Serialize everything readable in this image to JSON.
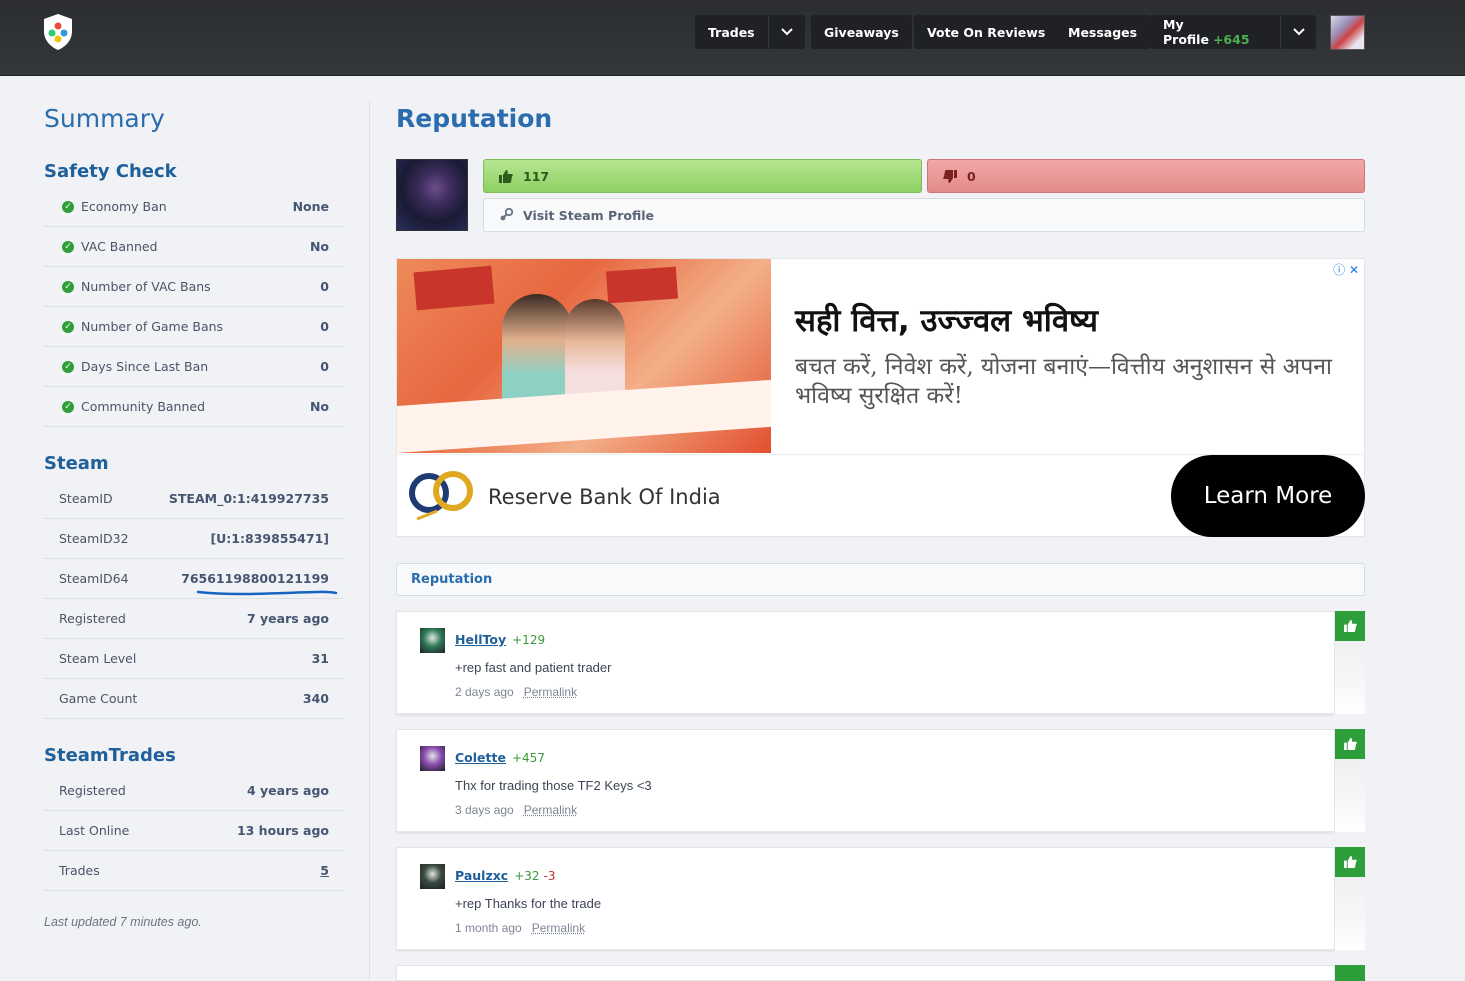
{
  "nav": {
    "trades": "Trades",
    "giveaways": "Giveaways",
    "vote_on_reviews": "Vote On Reviews",
    "messages": "Messages",
    "my_profile": "My Profile",
    "my_profile_points": "+645"
  },
  "sidebar": {
    "summary_title": "Summary",
    "safety_check": {
      "title": "Safety Check",
      "rows": [
        {
          "label": "Economy Ban",
          "value": "None"
        },
        {
          "label": "VAC Banned",
          "value": "No"
        },
        {
          "label": "Number of VAC Bans",
          "value": "0"
        },
        {
          "label": "Number of Game Bans",
          "value": "0"
        },
        {
          "label": "Days Since Last Ban",
          "value": "0"
        },
        {
          "label": "Community Banned",
          "value": "No"
        }
      ]
    },
    "steam": {
      "title": "Steam",
      "rows": [
        {
          "label": "SteamID",
          "value": "STEAM_0:1:419927735"
        },
        {
          "label": "SteamID32",
          "value": "[U:1:839855471]"
        },
        {
          "label": "SteamID64",
          "value": "76561198800121199"
        },
        {
          "label": "Registered",
          "value": "7 years ago"
        },
        {
          "label": "Steam Level",
          "value": "31"
        },
        {
          "label": "Game Count",
          "value": "340"
        }
      ]
    },
    "steamtrades": {
      "title": "SteamTrades",
      "rows": [
        {
          "label": "Registered",
          "value": "4 years ago"
        },
        {
          "label": "Last Online",
          "value": "13 hours ago"
        },
        {
          "label": "Trades",
          "value": "5"
        }
      ]
    },
    "last_updated": "Last updated 7 minutes ago."
  },
  "main": {
    "title": "Reputation",
    "positive": "117",
    "negative": "0",
    "visit_label": "Visit Steam Profile",
    "list_header": "Reputation"
  },
  "ad": {
    "headline": "सही वित्त, उज्ज्वल भविष्य",
    "body": "बचत करें, निवेश करें, योजना बनाएं—वित्तीय अनुशासन से अपना भविष्य सुरक्षित करें!",
    "brand": "Reserve Bank Of India",
    "cta": "Learn More",
    "info_icons": "ⓘ ✕"
  },
  "reviews": [
    {
      "name": "HellToy",
      "pos": "+129",
      "neg": "",
      "text": "+rep fast and patient trader",
      "date": "2 days ago",
      "permalink": "Permalink",
      "avatar_color": "#2f7a56"
    },
    {
      "name": "Colette",
      "pos": "+457",
      "neg": "",
      "text": "Thx for trading those TF2 Keys <3",
      "date": "3 days ago",
      "permalink": "Permalink",
      "avatar_color": "#8a4bb0"
    },
    {
      "name": "Paulzxc",
      "pos": "+32",
      "neg": "-3",
      "text": "+rep Thanks for the trade",
      "date": "1 month ago",
      "permalink": "Permalink",
      "avatar_color": "#3b4a3f"
    }
  ],
  "colors": {
    "accent": "#2a6cae",
    "positive": "#2e9e3a",
    "negative": "#c0392b"
  }
}
